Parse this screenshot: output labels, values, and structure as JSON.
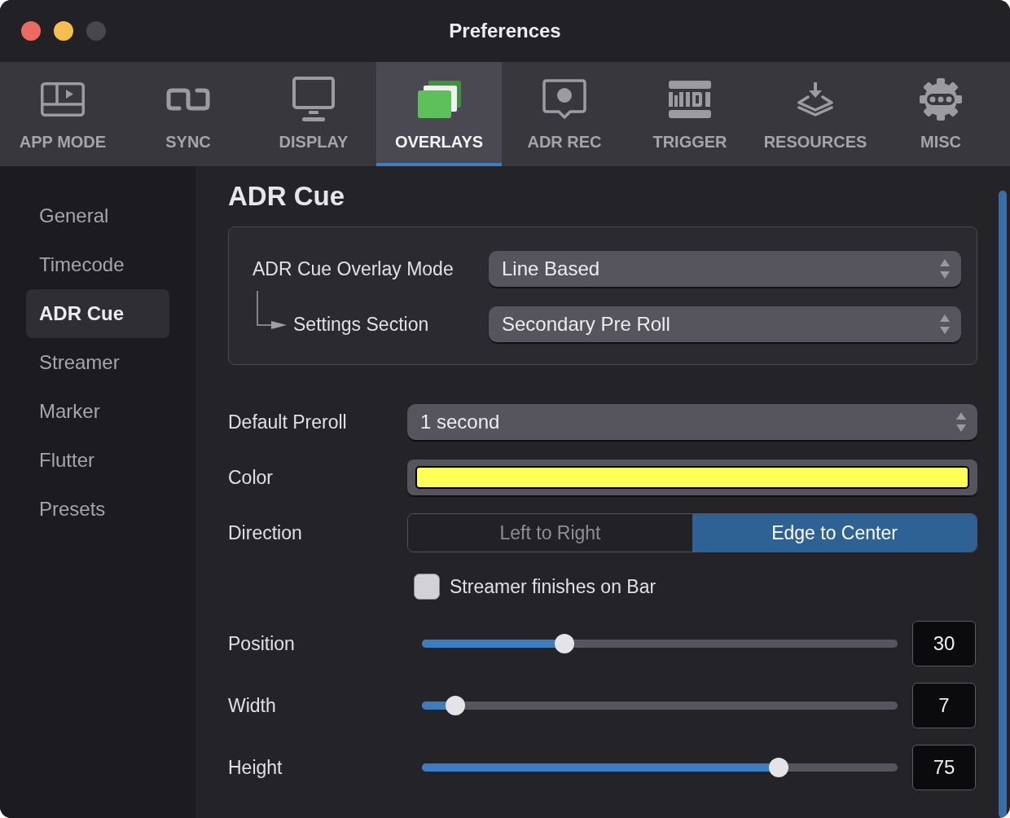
{
  "window": {
    "title": "Preferences",
    "buttons": [
      {
        "kind": "close",
        "disabled": false
      },
      {
        "kind": "minimize",
        "disabled": false
      },
      {
        "kind": "zoom",
        "disabled": true
      }
    ]
  },
  "toolbar": {
    "tabs": [
      {
        "label": "APP MODE",
        "selected": false
      },
      {
        "label": "SYNC",
        "selected": false
      },
      {
        "label": "DISPLAY",
        "selected": false
      },
      {
        "label": "OVERLAYS",
        "selected": true
      },
      {
        "label": "ADR REC",
        "selected": false
      },
      {
        "label": "TRIGGER",
        "selected": false
      },
      {
        "label": "RESOURCES",
        "selected": false
      },
      {
        "label": "MISC",
        "selected": false
      }
    ]
  },
  "sidebar": {
    "items": [
      {
        "label": "General",
        "selected": false
      },
      {
        "label": "Timecode",
        "selected": false
      },
      {
        "label": "ADR Cue",
        "selected": true
      },
      {
        "label": "Streamer",
        "selected": false
      },
      {
        "label": "Marker",
        "selected": false
      },
      {
        "label": "Flutter",
        "selected": false
      },
      {
        "label": "Presets",
        "selected": false
      }
    ]
  },
  "panel": {
    "title": "ADR Cue",
    "group": {
      "rows": [
        {
          "label": "ADR Cue Overlay Mode",
          "value": "Line Based",
          "children": [
            {
              "label": "Settings Section",
              "value": "Secondary Pre Roll"
            }
          ]
        }
      ]
    },
    "settings": [
      {
        "kind": "select",
        "label": "Default Preroll",
        "value": "1 second"
      },
      {
        "kind": "color",
        "label": "Color",
        "color": "#ffff55"
      },
      {
        "kind": "segmented",
        "label": "Direction",
        "options": [
          {
            "label": "Left to Right",
            "selected": false
          },
          {
            "label": "Edge to Center",
            "selected": true
          }
        ]
      },
      {
        "kind": "checkbox",
        "label": "Streamer finishes on Bar",
        "checked": false
      },
      {
        "kind": "slider",
        "label": "Position",
        "level": 0.3,
        "value": "30"
      },
      {
        "kind": "slider",
        "label": "Width",
        "level": 0.07,
        "value": "7"
      },
      {
        "kind": "slider",
        "label": "Height",
        "level": 0.75,
        "value": "75"
      }
    ]
  }
}
